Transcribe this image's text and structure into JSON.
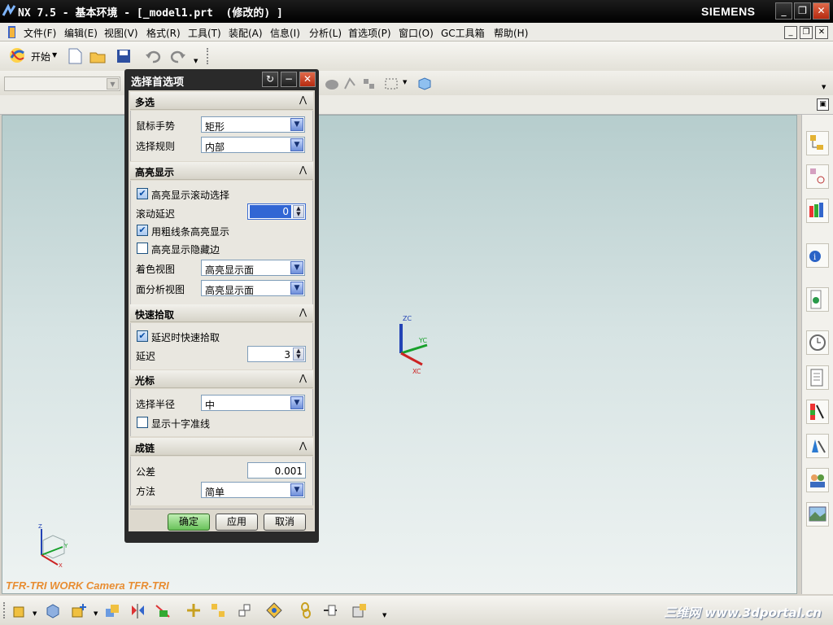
{
  "window": {
    "title": "NX 7.5 - 基本环境 - [_model1.prt  (修改的) ]",
    "brand": "SIEMENS"
  },
  "menu": {
    "items": [
      "文件(F)",
      "编辑(E)",
      "视图(V)",
      "格式(R)",
      "工具(T)",
      "装配(A)",
      "信息(I)",
      "分析(L)",
      "首选项(P)",
      "窗口(O)",
      "GC工具箱",
      "帮助(H)"
    ]
  },
  "toolbar": {
    "start_label": "开始"
  },
  "viewport": {
    "camera_label": "TFR-TRI WORK Camera TFR-TRI",
    "triad": {
      "zc": "ZC",
      "yc": "YC",
      "xc": "XC"
    },
    "mini_triad": {
      "z": "Z",
      "y": "Y",
      "x": "X"
    }
  },
  "watermark": "三维网 www.3dportal.cn",
  "dialog": {
    "title": "选择首选项",
    "sections": {
      "multi": {
        "title": "多选",
        "gesture_label": "鼠标手势",
        "gesture_value": "矩形",
        "rule_label": "选择规则",
        "rule_value": "内部"
      },
      "highlight": {
        "title": "高亮显示",
        "scroll_select": "高亮显示滚动选择",
        "scroll_delay_label": "滚动延迟",
        "scroll_delay_value": "0",
        "thick_lines": "用粗线条高亮显示",
        "hidden_edges": "高亮显示隐藏边",
        "shaded_label": "着色视图",
        "shaded_value": "高亮显示面",
        "analysis_label": "面分析视图",
        "analysis_value": "高亮显示面"
      },
      "quickpick": {
        "title": "快速拾取",
        "delayed": "延迟时快速拾取",
        "delay_label": "延迟",
        "delay_value": "3"
      },
      "cursor": {
        "title": "光标",
        "radius_label": "选择半径",
        "radius_value": "中",
        "crosshair": "显示十字准线"
      },
      "chaining": {
        "title": "成链",
        "tolerance_label": "公差",
        "tolerance_value": "0.001",
        "method_label": "方法",
        "method_value": "简单"
      }
    },
    "checks": {
      "scroll_select": true,
      "thick_lines": true,
      "hidden_edges": false,
      "delayed": true,
      "crosshair": false
    },
    "buttons": {
      "ok": "确定",
      "apply": "应用",
      "cancel": "取消"
    }
  },
  "colors": {
    "accent": "#e88d32",
    "dialog_frame": "#2a2a2a",
    "ok_button": "#69c25a"
  }
}
